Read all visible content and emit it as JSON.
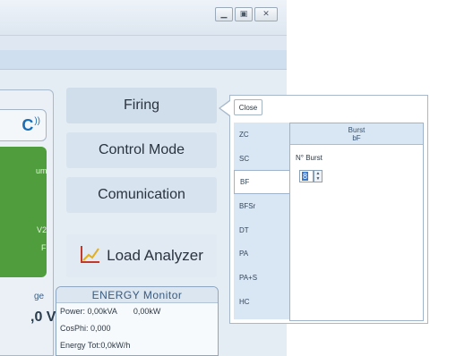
{
  "window": {
    "controls": {
      "minimize": "▁",
      "maximize": "▣",
      "close": "✕"
    }
  },
  "left_panel": {
    "logo_mark": "C",
    "logo_wave": "))",
    "green_text_1": "um",
    "green_text_2": "V2",
    "green_text_3": "F",
    "voltage_label": "ge",
    "voltage_value": ",0 V"
  },
  "menu": {
    "firing": "Firing",
    "control_mode": "Control Mode",
    "comunication": "Comunication",
    "load_analyzer": "Load Analyzer"
  },
  "energy_monitor": {
    "title": "ENERGY Monitor",
    "power_kva": "Power: 0,00kVA",
    "power_kw": "0,00kW",
    "cosphi": "CosPhi: 0,000",
    "energy_tot": "Energy Tot:0,0kW/h"
  },
  "popup": {
    "close_label": "Close",
    "modes": [
      "ZC",
      "SC",
      "BF",
      "BFSr",
      "DT",
      "PA",
      "PA+S",
      "HC"
    ],
    "selected_mode": "BF",
    "config": {
      "header_title": "Burst",
      "header_subtitle": "bF",
      "nburst_label": "N° Burst",
      "nburst_value": "8"
    }
  },
  "colors": {
    "green_panel": "#4f9d3c",
    "accent_blue": "#1a6cb5"
  }
}
